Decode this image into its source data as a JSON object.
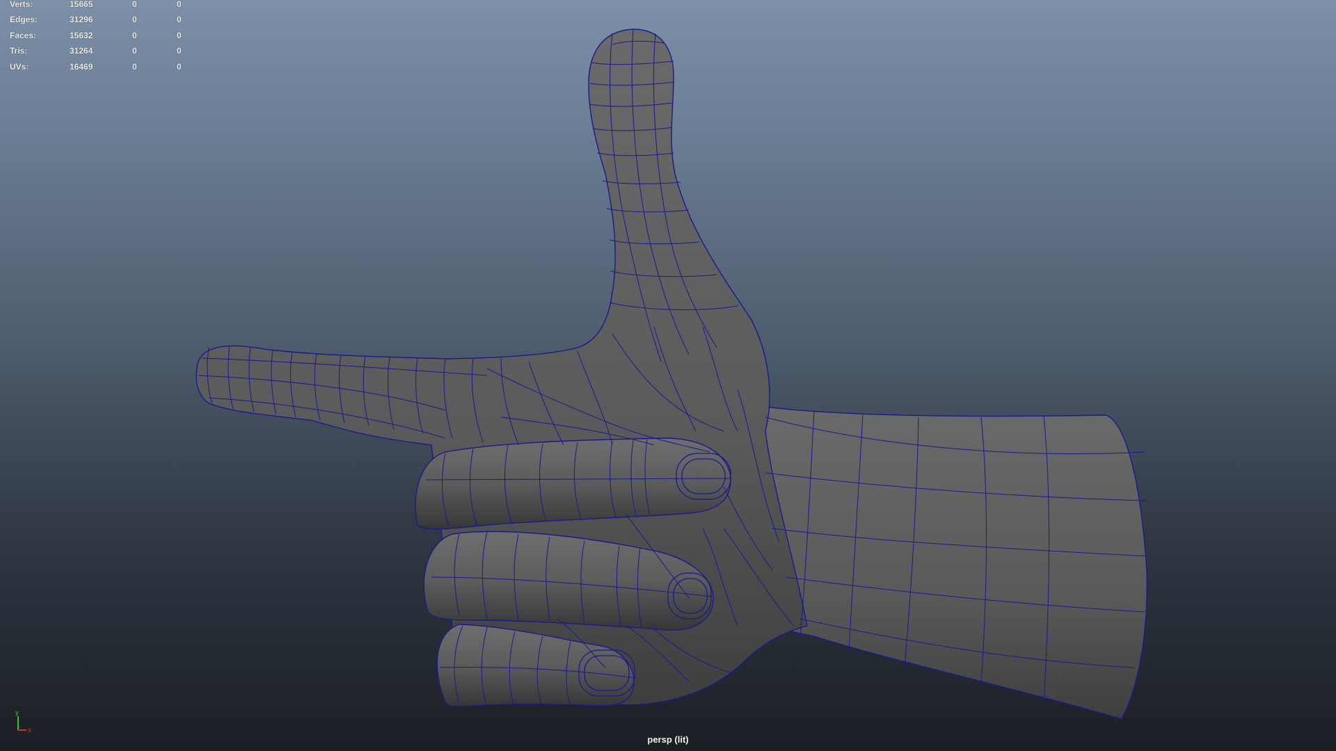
{
  "hud": {
    "rows": [
      {
        "label": "Verts:",
        "total": "15665",
        "selected": "0",
        "component": "0"
      },
      {
        "label": "Edges:",
        "total": "31296",
        "selected": "0",
        "component": "0"
      },
      {
        "label": "Faces:",
        "total": "15632",
        "selected": "0",
        "component": "0"
      },
      {
        "label": "Tris:",
        "total": "31264",
        "selected": "0",
        "component": "0"
      },
      {
        "label": "UVs:",
        "total": "16469",
        "selected": "0",
        "component": "0"
      }
    ]
  },
  "axis": {
    "y": "y",
    "x": "x"
  },
  "camera_label": "persp (lit)",
  "colors": {
    "mesh_fill": "#5c5c5c",
    "wire": "#1a1a8c",
    "axis_y": "#38c038",
    "axis_x": "#d03030",
    "bg_top": "#7e90a8",
    "bg_bottom": "#1b1f24"
  }
}
